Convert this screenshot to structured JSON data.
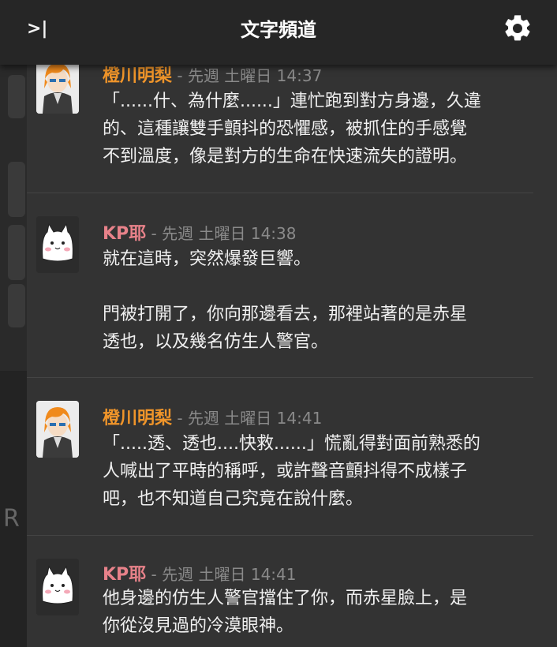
{
  "header": {
    "toggle_label": ">|",
    "title": "文字頻道",
    "settings_icon": "gear-icon"
  },
  "sidebar_fragment": {
    "char": "R"
  },
  "messages": [
    {
      "author": "橙川明梨",
      "separator": " - ",
      "timestamp": "先週 土曜日 14:37",
      "avatar": "orange-hair-character-avatar",
      "name_color": "#f0952a",
      "lines": [
        "「......什、為什麼......」連忙跑到對方身邊，久違",
        "的、這種讓雙手顫抖的恐懼感，被抓住的手感覺",
        "不到溫度，像是對方的生命在快速流失的證明。"
      ]
    },
    {
      "author": "KP耶",
      "separator": " - ",
      "timestamp": "先週 土曜日 14:38",
      "avatar": "white-cat-avatar",
      "name_color": "#e8828a",
      "lines": [
        "就在這時，突然爆發巨響。",
        "",
        "門被打開了，你向那邊看去，那裡站著的是赤星",
        "透也，以及幾名仿生人警官。"
      ]
    },
    {
      "author": "橙川明梨",
      "separator": " - ",
      "timestamp": "先週 土曜日 14:41",
      "avatar": "orange-hair-character-avatar",
      "name_color": "#f0952a",
      "lines": [
        "「.....透、透也....快救......」慌亂得對面前熟悉的",
        "人喊出了平時的稱呼，或許聲音顫抖得不成樣子",
        "吧，也不知道自己究竟在說什麼。"
      ]
    },
    {
      "author": "KP耶",
      "separator": " - ",
      "timestamp": "先週 土曜日 14:41",
      "avatar": "white-cat-avatar",
      "name_color": "#e8828a",
      "lines": [
        "他身邊的仿生人警官擋住了你，而赤星臉上，是",
        "你從沒見過的冷漠眼神。"
      ]
    }
  ]
}
